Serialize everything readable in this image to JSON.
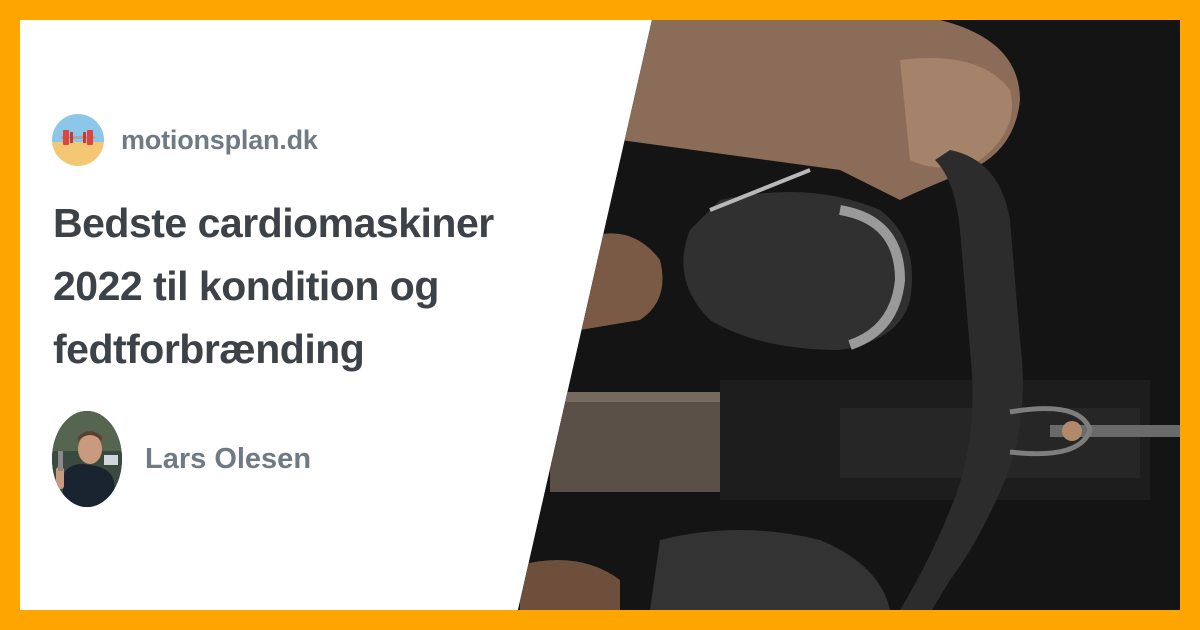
{
  "site": {
    "name": "motionsplan.dk",
    "logo_icon": "barbell-icon"
  },
  "article": {
    "title_lines": [
      "Bedste cardiomaskiner",
      "2022 til kondition og",
      "fedtforbrænding"
    ]
  },
  "author": {
    "name": "Lars Olesen"
  },
  "colors": {
    "frame": "#ffa500",
    "panel": "#ffffff",
    "title_text": "#3d4248",
    "meta_text": "#707a84"
  }
}
